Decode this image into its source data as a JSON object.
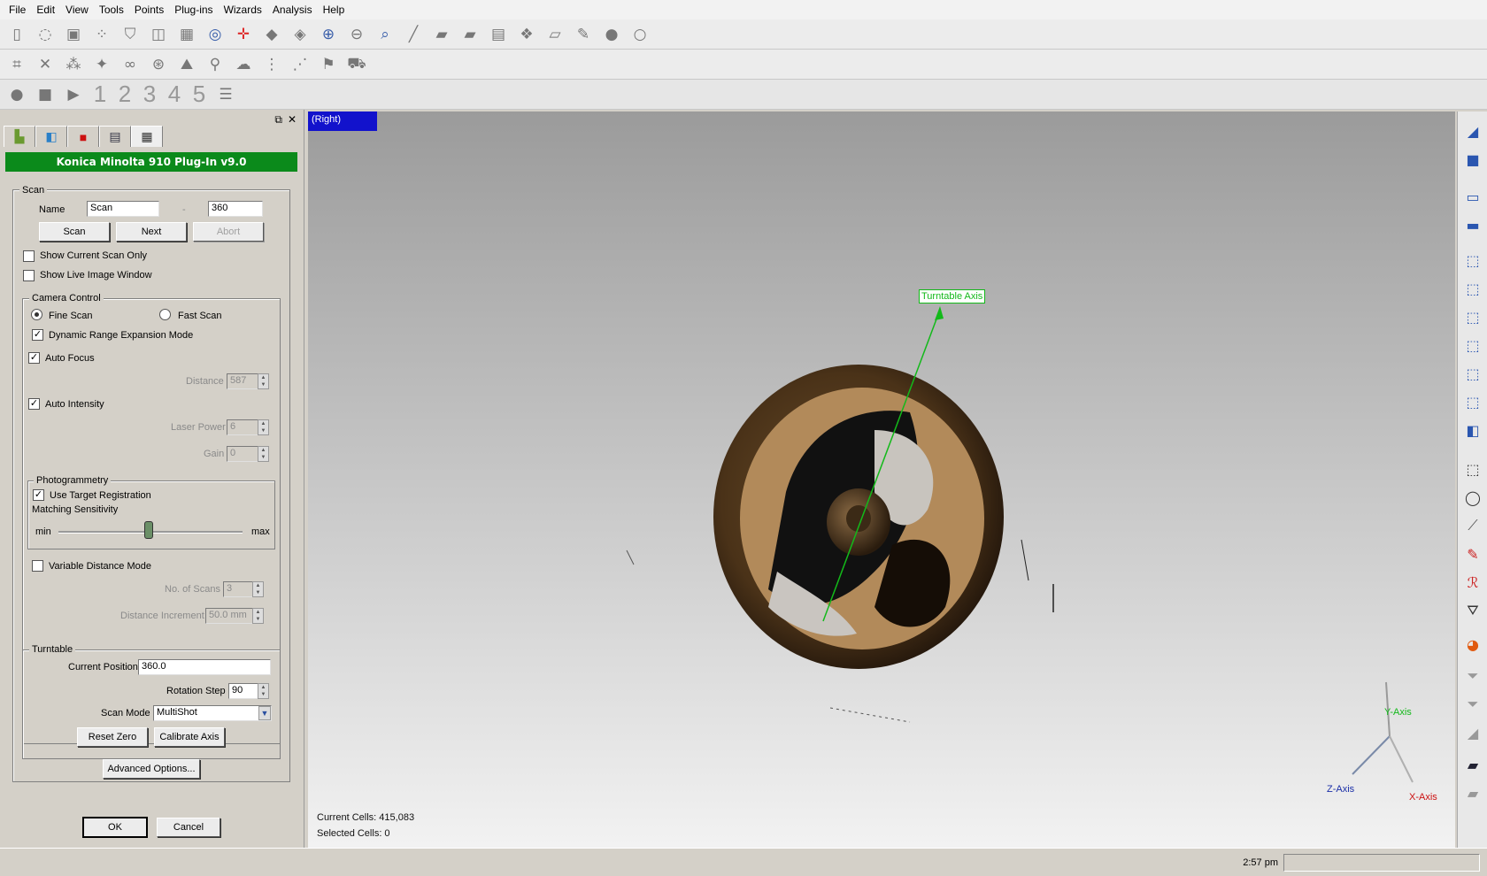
{
  "menu": [
    "File",
    "Edit",
    "View",
    "Tools",
    "Points",
    "Plug-ins",
    "Wizards",
    "Analysis",
    "Help"
  ],
  "panel": {
    "title": "Konica Minolta 910 Plug-In v9.0",
    "scan": {
      "legend": "Scan",
      "name_label": "Name",
      "name_value": "Scan",
      "separator": "-",
      "number_value": "360",
      "scan_button": "Scan",
      "next_button": "Next",
      "abort_button": "Abort",
      "show_current_only": "Show Current Scan Only",
      "show_live_image": "Show Live Image Window"
    },
    "camera": {
      "legend": "Camera Control",
      "fine_scan": "Fine Scan",
      "fast_scan": "Fast Scan",
      "dynamic_range": "Dynamic Range Expansion Mode",
      "auto_focus": "Auto Focus",
      "distance_label": "Distance",
      "distance_value": "587",
      "auto_intensity": "Auto Intensity",
      "laser_power_label": "Laser Power",
      "laser_power_value": "6",
      "gain_label": "Gain",
      "gain_value": "0",
      "variable_distance": "Variable Distance Mode",
      "no_scans_label": "No. of Scans",
      "no_scans_value": "3",
      "distance_increment_label": "Distance Increment",
      "distance_increment_value": "50.0 mm"
    },
    "photogrammetry": {
      "legend": "Photogrammetry",
      "use_target": "Use Target Registration",
      "matching": "Matching Sensitivity",
      "min": "min",
      "max": "max",
      "sensitivity_fraction": 0.49
    },
    "turntable": {
      "legend": "Turntable",
      "current_position_label": "Current Position",
      "current_position_value": "360.0",
      "rotation_step_label": "Rotation Step",
      "rotation_step_value": "90",
      "scan_mode_label": "Scan Mode",
      "scan_mode_value": "MultiShot",
      "reset_zero": "Reset Zero",
      "calibrate_axis": "Calibrate Axis"
    },
    "advanced": "Advanced Options...",
    "ok": "OK",
    "cancel": "Cancel"
  },
  "viewport": {
    "view_name": "(Right)",
    "turntable_axis": "Turntable Axis",
    "current_cells": "Current Cells: 415,083",
    "selected_cells": "Selected Cells: 0",
    "y_axis": "Y-Axis",
    "z_axis": "Z-Axis",
    "x_axis": "X-Axis"
  },
  "toolbar3_numbers": [
    "1",
    "2",
    "3",
    "4",
    "5"
  ],
  "status": {
    "time": "2:57 pm"
  },
  "colors": {
    "title_green": "#0b8a1b",
    "view_blue": "#1212cc",
    "axis_green": "#13b91a",
    "x_axis_red": "#cc1111",
    "z_axis_blue": "#1b2fa8"
  }
}
